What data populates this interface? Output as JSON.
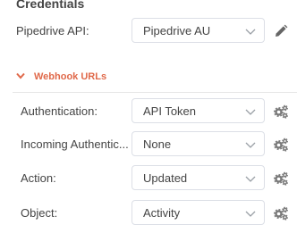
{
  "header": {
    "title": "Credentials"
  },
  "credentials": {
    "label": "Pipedrive API:",
    "value": "Pipedrive AU"
  },
  "section": {
    "label": "Webhook URLs"
  },
  "fields": [
    {
      "label": "Authentication:",
      "value": "API Token"
    },
    {
      "label": "Incoming Authentic...",
      "value": "None"
    },
    {
      "label": "Action:",
      "value": "Updated"
    },
    {
      "label": "Object:",
      "value": "Activity"
    }
  ],
  "icons": {
    "credential_action": "pencil-icon",
    "field_action": "gears-icon",
    "section_toggle": "chevron-down-icon",
    "select_toggle": "chevron-down-icon"
  },
  "colors": {
    "accent": "#e0694a",
    "text": "#444444",
    "border": "#dcdfe6",
    "icon": "#7a7a7a"
  }
}
